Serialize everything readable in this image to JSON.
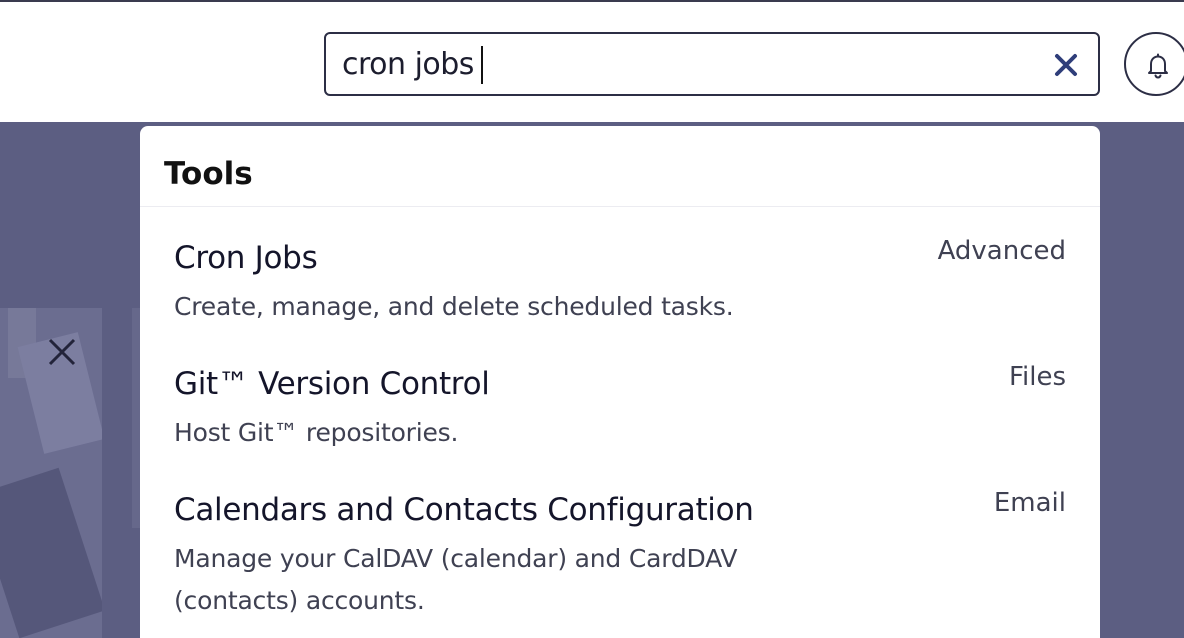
{
  "search": {
    "value": "cron jobs",
    "clear_icon": "close-icon"
  },
  "header": {
    "notifications_icon": "bell-icon"
  },
  "results_panel": {
    "section_title": "Tools",
    "items": [
      {
        "title": "Cron Jobs",
        "description": "Create, manage, and delete scheduled tasks.",
        "category": "Advanced"
      },
      {
        "title": "Git™ Version Control",
        "description": "Host Git™ repositories.",
        "category": "Files"
      },
      {
        "title": "Calendars and Contacts Configuration",
        "description": "Manage your CalDAV (calendar) and CardDAV (contacts) accounts.",
        "category": "Email"
      }
    ]
  },
  "colors": {
    "overlay": "#5c5e82",
    "border": "#2c2e45",
    "clear_icon": "#2f3e7a"
  }
}
